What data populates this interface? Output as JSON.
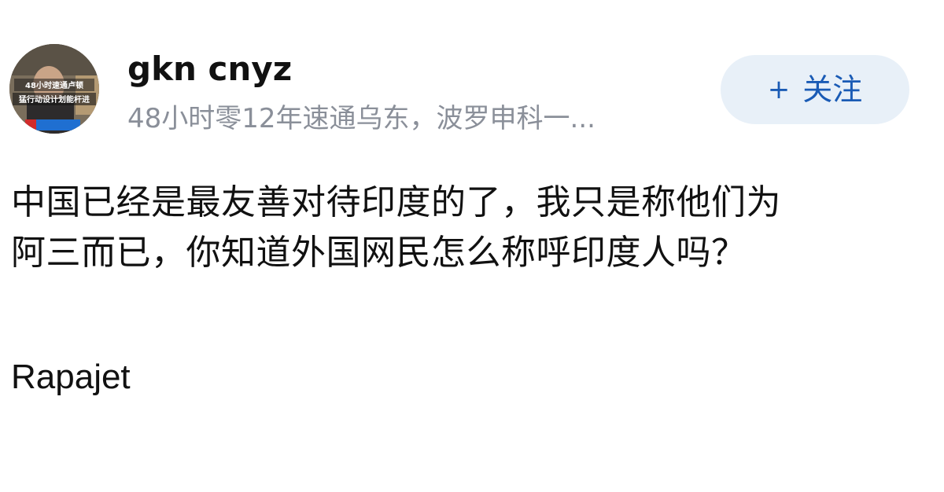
{
  "author": {
    "name": "gkn cnyz",
    "bio": "48小时零12年速通乌东，波罗申科一...",
    "avatar_icon": "news-broadcast-avatar",
    "avatar_caption_top": "48小时速通卢顿",
    "avatar_caption_bottom": "猛行动设计划能杆进"
  },
  "follow": {
    "plus": "+",
    "label": "关注",
    "accent_color": "#1a5bb5",
    "background_color": "#e8f0f8"
  },
  "post": {
    "lines": [
      "中国已经是最友善对待印度的了，我只是称他们为",
      "阿三而已，你知道外国网民怎么称呼印度人吗？"
    ],
    "extra": "Rapajet"
  }
}
